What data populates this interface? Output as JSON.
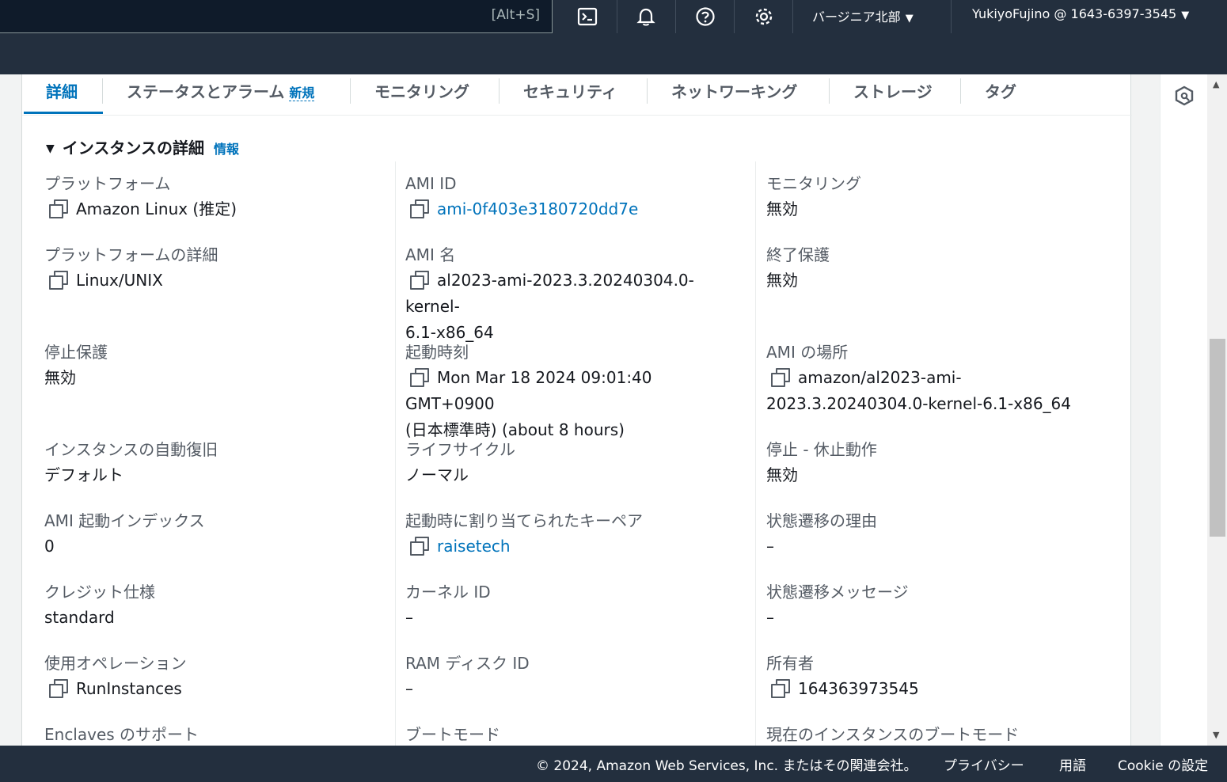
{
  "topnav": {
    "search_shortcut": "[Alt+S]",
    "icons": [
      "cloudshell-icon",
      "bell-icon",
      "help-icon",
      "gear-icon"
    ],
    "region": "バージニア北部",
    "account": "YukiyoFujino @ 1643-6397-3545"
  },
  "tabs": {
    "details": "詳細",
    "status": "ステータスとアラーム",
    "status_badge": "新規",
    "monitoring": "モニタリング",
    "security": "セキュリティ",
    "networking": "ネットワーキング",
    "storage": "ストレージ",
    "tags": "タグ"
  },
  "section": {
    "title": "インスタンスの詳細",
    "info": "情報"
  },
  "col1": {
    "platform_label": "プラットフォーム",
    "platform_value": "Amazon Linux (推定)",
    "platform_details_label": "プラットフォームの詳細",
    "platform_details_value": "Linux/UNIX",
    "stop_protection_label": "停止保護",
    "stop_protection_value": "無効",
    "auto_recovery_label": "インスタンスの自動復旧",
    "auto_recovery_value": "デフォルト",
    "ami_launch_index_label": "AMI 起動インデックス",
    "ami_launch_index_value": "0",
    "credit_label": "クレジット仕様",
    "credit_value": "standard",
    "usage_op_label": "使用オペレーション",
    "usage_op_value": "RunInstances",
    "enclaves_label": "Enclaves のサポート"
  },
  "col2": {
    "ami_id_label": "AMI ID",
    "ami_id_value": "ami-0f403e3180720dd7e",
    "ami_name_label": "AMI 名",
    "ami_name_value_1": "al2023-ami-2023.3.20240304.0-kernel-",
    "ami_name_value_2": "6.1-x86_64",
    "launch_time_label": "起動時刻",
    "launch_time_value_1": "Mon Mar 18 2024 09:01:40 GMT+0900",
    "launch_time_value_2": "(日本標準時) (about 8 hours)",
    "lifecycle_label": "ライフサイクル",
    "lifecycle_value": "ノーマル",
    "keypair_label": "起動時に割り当てられたキーペア",
    "keypair_value": "raisetech",
    "kernel_label": "カーネル ID",
    "kernel_value": "–",
    "ramdisk_label": "RAM ディスク ID",
    "ramdisk_value": "–",
    "boot_mode_label": "ブートモード"
  },
  "col3": {
    "monitoring_label": "モニタリング",
    "monitoring_value": "無効",
    "termination_label": "終了保護",
    "termination_value": "無効",
    "ami_location_label": "AMI の場所",
    "ami_location_value_1": "amazon/al2023-ami-",
    "ami_location_value_2": "2023.3.20240304.0-kernel-6.1-x86_64",
    "stop_hibernate_label": "停止 - 休止動作",
    "stop_hibernate_value": "無効",
    "state_reason_label": "状態遷移の理由",
    "state_reason_value": "–",
    "state_message_label": "状態遷移メッセージ",
    "state_message_value": "–",
    "owner_label": "所有者",
    "owner_value": "164363973545",
    "current_boot_label": "現在のインスタンスのブートモード"
  },
  "footer": {
    "copyright": "© 2024, Amazon Web Services, Inc. またはその関連会社。",
    "privacy": "プライバシー",
    "terms": "用語",
    "cookies": "Cookie の設定"
  },
  "colors": {
    "nav_bg": "#232f3e",
    "link": "#0073bb",
    "label": "#545b64"
  }
}
